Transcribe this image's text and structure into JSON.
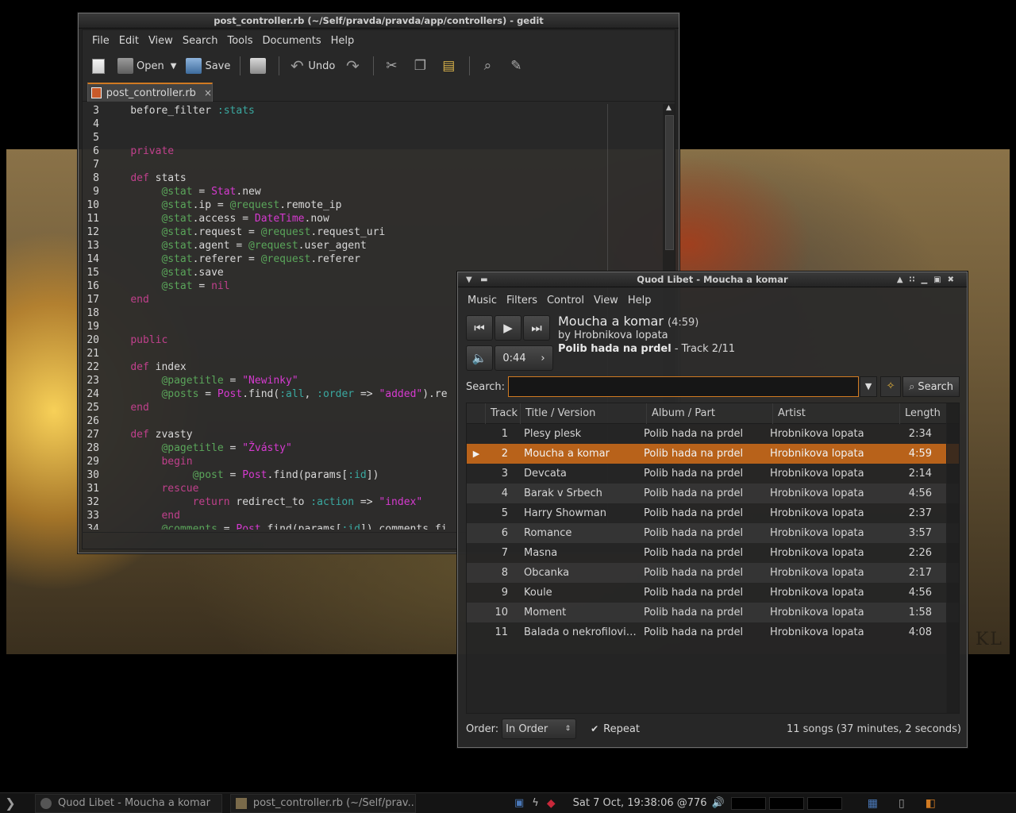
{
  "gedit": {
    "title": "post_controller.rb (~/Self/pravda/pravda/app/controllers) - gedit",
    "menu": [
      "File",
      "Edit",
      "View",
      "Search",
      "Tools",
      "Documents",
      "Help"
    ],
    "toolbar": {
      "open": "Open",
      "save": "Save",
      "undo": "Undo"
    },
    "tab": "post_controller.rb",
    "tab_close": "×",
    "code": [
      {
        "n": "3",
        "t": "    before_filter :stats"
      },
      {
        "n": "4",
        "t": ""
      },
      {
        "n": "5",
        "t": ""
      },
      {
        "n": "6",
        "t": "    private"
      },
      {
        "n": "7",
        "t": ""
      },
      {
        "n": "8",
        "t": "    def stats"
      },
      {
        "n": "9",
        "t": "         @stat = Stat.new"
      },
      {
        "n": "10",
        "t": "         @stat.ip = @request.remote_ip"
      },
      {
        "n": "11",
        "t": "         @stat.access = DateTime.now"
      },
      {
        "n": "12",
        "t": "         @stat.request = @request.request_uri"
      },
      {
        "n": "13",
        "t": "         @stat.agent = @request.user_agent"
      },
      {
        "n": "14",
        "t": "         @stat.referer = @request.referer"
      },
      {
        "n": "15",
        "t": "         @stat.save"
      },
      {
        "n": "16",
        "t": "         @stat = nil"
      },
      {
        "n": "17",
        "t": "    end"
      },
      {
        "n": "18",
        "t": ""
      },
      {
        "n": "19",
        "t": ""
      },
      {
        "n": "20",
        "t": "    public"
      },
      {
        "n": "21",
        "t": ""
      },
      {
        "n": "22",
        "t": "    def index"
      },
      {
        "n": "23",
        "t": "         @pagetitle = \"Newinky\""
      },
      {
        "n": "24",
        "t": "         @posts = Post.find(:all, :order => \"added\").re"
      },
      {
        "n": "25",
        "t": "    end"
      },
      {
        "n": "26",
        "t": ""
      },
      {
        "n": "27",
        "t": "    def zvasty"
      },
      {
        "n": "28",
        "t": "         @pagetitle = \"Žvásty\""
      },
      {
        "n": "29",
        "t": "         begin"
      },
      {
        "n": "30",
        "t": "              @post = Post.find(params[:id])"
      },
      {
        "n": "31",
        "t": "         rescue"
      },
      {
        "n": "32",
        "t": "              return redirect_to :action => \"index\""
      },
      {
        "n": "33",
        "t": "         end"
      },
      {
        "n": "34",
        "t": "         @comments = Post.find(params[:id]).comments.fi"
      }
    ]
  },
  "quodlibet": {
    "title": "Quod Libet - Moucha a komar",
    "menu": [
      "Music",
      "Filters",
      "Control",
      "View",
      "Help"
    ],
    "now_playing": {
      "title": "Moucha a komar",
      "duration": "(4:59)",
      "artist_line": "by Hrobnikova lopata",
      "album": "Polib hada na prdel",
      "track_info": " - Track 2/11"
    },
    "position": "0:44",
    "search_label": "Search:",
    "search_value": "",
    "search_button": "Search",
    "columns": [
      "Track",
      "Title / Version",
      "Album / Part",
      "Artist",
      "Length"
    ],
    "songs": [
      {
        "track": "1",
        "title": "Plesy plesk",
        "album": "Polib hada na prdel",
        "artist": "Hrobnikova lopata",
        "length": "2:34"
      },
      {
        "track": "2",
        "title": "Moucha a komar",
        "album": "Polib hada na prdel",
        "artist": "Hrobnikova lopata",
        "length": "4:59",
        "playing": true
      },
      {
        "track": "3",
        "title": "Devcata",
        "album": "Polib hada na prdel",
        "artist": "Hrobnikova lopata",
        "length": "2:14"
      },
      {
        "track": "4",
        "title": "Barak v Srbech",
        "album": "Polib hada na prdel",
        "artist": "Hrobnikova lopata",
        "length": "4:56"
      },
      {
        "track": "5",
        "title": "Harry Showman",
        "album": "Polib hada na prdel",
        "artist": "Hrobnikova lopata",
        "length": "2:37"
      },
      {
        "track": "6",
        "title": "Romance",
        "album": "Polib hada na prdel",
        "artist": "Hrobnikova lopata",
        "length": "3:57"
      },
      {
        "track": "7",
        "title": "Masna",
        "album": "Polib hada na prdel",
        "artist": "Hrobnikova lopata",
        "length": "2:26"
      },
      {
        "track": "8",
        "title": "Obcanka",
        "album": "Polib hada na prdel",
        "artist": "Hrobnikova lopata",
        "length": "2:17"
      },
      {
        "track": "9",
        "title": "Koule",
        "album": "Polib hada na prdel",
        "artist": "Hrobnikova lopata",
        "length": "4:56"
      },
      {
        "track": "10",
        "title": "Moment",
        "album": "Polib hada na prdel",
        "artist": "Hrobnikova lopata",
        "length": "1:58"
      },
      {
        "track": "11",
        "title": "Balada o nekrofilovi Li…",
        "album": "Polib hada na prdel",
        "artist": "Hrobnikova lopata",
        "length": "4:08"
      }
    ],
    "order_label": "Order:",
    "order_value": "In Order",
    "repeat_label": "Repeat",
    "song_count": "11 songs (37 minutes, 2 seconds)"
  },
  "taskbar": {
    "tasks": [
      "Quod Libet - Moucha a komar",
      "post_controller.rb (~/Self/prav..."
    ],
    "clock": "Sat  7 Oct, 19:38:06 @776"
  },
  "wallpaper": {
    "signature": "KL"
  },
  "colors": {
    "accent": "#d07a22",
    "selection": "#b8621a",
    "keyword": "#c0408c",
    "ivar": "#5aa55a",
    "symbol": "#3aa8a0",
    "string": "#d63ad0"
  }
}
